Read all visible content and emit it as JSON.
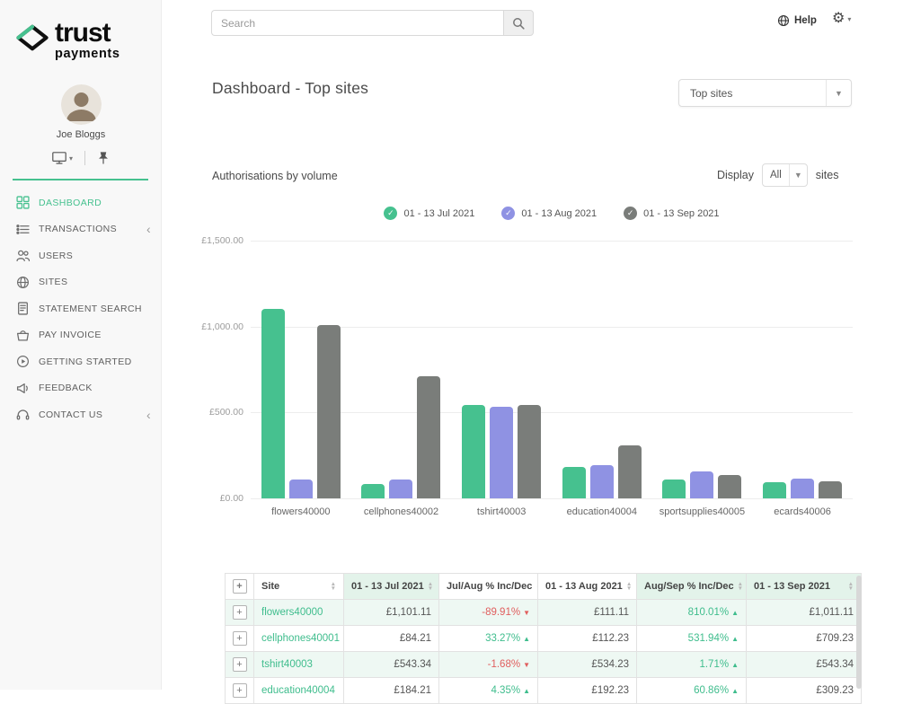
{
  "brand": {
    "line1": "trust",
    "line2": "payments"
  },
  "user": {
    "name": "Joe Bloggs"
  },
  "topbar": {
    "search_placeholder": "Search",
    "help_label": "Help"
  },
  "sidebar": {
    "items": [
      {
        "label": "DASHBOARD",
        "icon": "dashboard-icon",
        "active": true
      },
      {
        "label": "TRANSACTIONS",
        "icon": "transactions-icon",
        "chevron": true
      },
      {
        "label": "USERS",
        "icon": "users-icon"
      },
      {
        "label": "SITES",
        "icon": "sites-icon"
      },
      {
        "label": "STATEMENT SEARCH",
        "icon": "statement-search-icon"
      },
      {
        "label": "PAY INVOICE",
        "icon": "pay-invoice-icon"
      },
      {
        "label": "GETTING STARTED",
        "icon": "getting-started-icon"
      },
      {
        "label": "FEEDBACK",
        "icon": "feedback-icon"
      },
      {
        "label": "CONTACT US",
        "icon": "contact-us-icon",
        "chevron": true
      }
    ]
  },
  "page": {
    "title": "Dashboard - Top sites",
    "report_filter_value": "Top sites"
  },
  "section": {
    "title": "Authorisations by volume",
    "display_label": "Display",
    "display_value": "All",
    "display_suffix": "sites"
  },
  "colors": {
    "brand_green": "#46c18f",
    "series_purple": "#8f92e3",
    "series_gray": "#7a7d7a",
    "positive": "#3fbd8d",
    "negative": "#e05e5e"
  },
  "chart_data": {
    "type": "bar",
    "title": "Authorisations by volume",
    "categories": [
      "flowers40000",
      "cellphones40002",
      "tshirt40003",
      "education40004",
      "sportsupplies40005",
      "ecards40006"
    ],
    "series": [
      {
        "name": "01 - 13 Jul 2021",
        "color": "#46c18f",
        "values": [
          1101.11,
          84.21,
          543.34,
          184.21,
          110,
          95
        ]
      },
      {
        "name": "01 - 13 Aug 2021",
        "color": "#8f92e3",
        "values": [
          111.11,
          112.23,
          534.23,
          192.23,
          155,
          115
        ]
      },
      {
        "name": "01 - 13 Sep 2021",
        "color": "#7a7d7a",
        "values": [
          1011.11,
          709.23,
          543.34,
          309.23,
          135,
          100
        ]
      }
    ],
    "ylim": [
      0,
      1500
    ],
    "ytick_labels": [
      "£1,500.00",
      "£1,000.00",
      "£500.00",
      "£0.00"
    ],
    "grid": true,
    "legend_position": "top"
  },
  "table": {
    "expand_symbol": "+",
    "headers": [
      {
        "label": "Site",
        "highlighted": false
      },
      {
        "label": "01 - 13 Jul 2021",
        "highlighted": true
      },
      {
        "label": "Jul/Aug % Inc/Dec",
        "highlighted": false
      },
      {
        "label": "01 - 13 Aug 2021",
        "highlighted": false
      },
      {
        "label": "Aug/Sep % Inc/Dec",
        "highlighted": true
      },
      {
        "label": "01 - 13 Sep 2021",
        "highlighted": true
      }
    ],
    "rows": [
      {
        "site": "flowers40000",
        "jul": "£1,101.11",
        "jul_aug_pct": "-89.91%",
        "jul_aug_dir": "down",
        "aug": "£111.11",
        "aug_sep_pct": "810.01%",
        "aug_sep_dir": "up",
        "sep": "£1,011.11"
      },
      {
        "site": "cellphones40001",
        "jul": "£84.21",
        "jul_aug_pct": "33.27%",
        "jul_aug_dir": "up",
        "aug": "£112.23",
        "aug_sep_pct": "531.94%",
        "aug_sep_dir": "up",
        "sep": "£709.23"
      },
      {
        "site": "tshirt40003",
        "jul": "£543.34",
        "jul_aug_pct": "-1.68%",
        "jul_aug_dir": "down",
        "aug": "£534.23",
        "aug_sep_pct": "1.71%",
        "aug_sep_dir": "up",
        "sep": "£543.34"
      },
      {
        "site": "education40004",
        "jul": "£184.21",
        "jul_aug_pct": "4.35%",
        "jul_aug_dir": "up",
        "aug": "£192.23",
        "aug_sep_pct": "60.86%",
        "aug_sep_dir": "up",
        "sep": "£309.23"
      }
    ]
  }
}
